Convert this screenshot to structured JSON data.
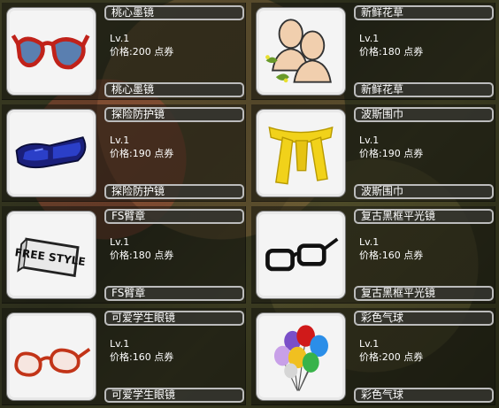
{
  "items": [
    {
      "name": "桃心墨镜",
      "level": "Lv.1",
      "price": "价格:200 点券",
      "icon": "heart-sunglasses-icon"
    },
    {
      "name": "新鲜花草",
      "level": "Lv.1",
      "price": "价格:180 点券",
      "icon": "flower-grass-icon"
    },
    {
      "name": "探险防护镜",
      "level": "Lv.1",
      "price": "价格:190 点券",
      "icon": "goggles-icon"
    },
    {
      "name": "波斯围巾",
      "level": "Lv.1",
      "price": "价格:190 点券",
      "icon": "scarf-icon"
    },
    {
      "name": "FS臂章",
      "level": "Lv.1",
      "price": "价格:180 点券",
      "icon": "armband-icon"
    },
    {
      "name": "复古黑框平光镜",
      "level": "Lv.1",
      "price": "价格:160 点券",
      "icon": "black-frame-glasses-icon"
    },
    {
      "name": "可爱学生眼镜",
      "level": "Lv.1",
      "price": "价格:160 点券",
      "icon": "student-glasses-icon"
    },
    {
      "name": "彩色气球",
      "level": "Lv.1",
      "price": "价格:200 点券",
      "icon": "balloons-icon"
    }
  ],
  "armband_text": "FREE STYLE",
  "colors": {
    "label_border": "#bcbcbc",
    "thumb_border": "#e8e8e8"
  }
}
